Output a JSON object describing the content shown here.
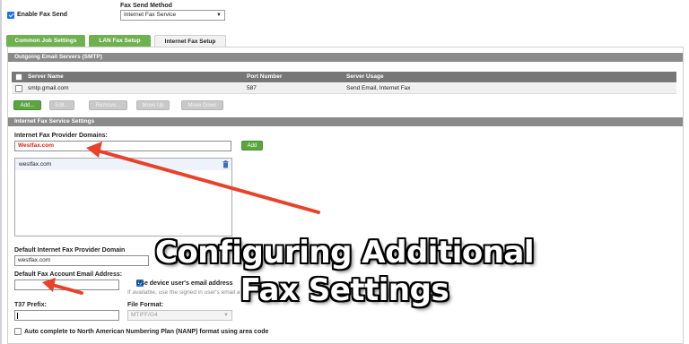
{
  "header": {
    "enable_fax_send_label": "Enable Fax Send",
    "fax_send_method_label": "Fax Send Method",
    "fax_send_method_value": "Internet Fax Service"
  },
  "tabs": [
    {
      "label": "Common Job Settings",
      "active": false
    },
    {
      "label": "LAN Fax Setup",
      "active": false
    },
    {
      "label": "Internet Fax Setup",
      "active": true
    }
  ],
  "smtp": {
    "section_title": "Outgoing Email Servers (SMTP)",
    "columns": [
      "Server Name",
      "Port Number",
      "Server Usage"
    ],
    "rows": [
      {
        "server": "smtp.gmail.com",
        "port": "587",
        "usage": "Send Email, Internet Fax"
      }
    ],
    "buttons": {
      "add": "Add...",
      "edit": "Edit...",
      "remove": "Remove...",
      "move_up": "Move Up",
      "move_down": "Move Down"
    }
  },
  "ifax": {
    "section_title": "Internet Fax Service Settings",
    "provider_domains_label": "Internet Fax Provider Domains:",
    "provider_domain_input": "Westfax.com",
    "add_button": "Add",
    "domains_list": [
      "westfax.com"
    ],
    "default_domain_label": "Default Internet Fax Provider Domain",
    "default_domain_value": "westfax.com",
    "default_email_label": "Default Fax Account Email Address:",
    "use_device_email_label": "Use device user's email address",
    "use_device_email_hint": "If available, use the signed in user's email a",
    "t37_label": "T37 Prefix:",
    "file_format_label": "File Format:",
    "file_format_value": "MTIFF/G4",
    "nanp_label": "Auto complete to North American Numbering Plan (NANP) format using area code"
  },
  "overlay": {
    "line1": "Configuring Additional",
    "line2": "Fax Settings",
    "arrow_color": "#e8432a"
  }
}
